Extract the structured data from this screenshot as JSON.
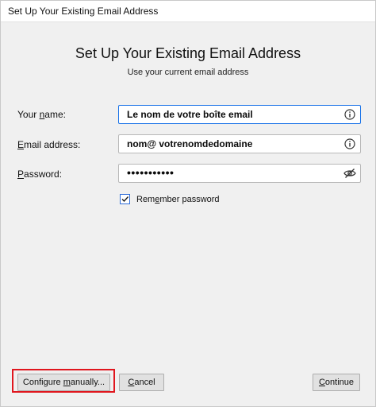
{
  "window": {
    "title": "Set Up Your Existing Email Address"
  },
  "header": {
    "title": "Set Up Your Existing Email Address",
    "subtitle": "Use your current email address"
  },
  "form": {
    "name_label_pre": "Your ",
    "name_label_mn": "n",
    "name_label_post": "ame:",
    "name_value": "Le nom de votre boîte email",
    "email_label_pre": "",
    "email_label_mn": "E",
    "email_label_post": "mail address:",
    "email_value": "nom@ votrenomdedomaine",
    "password_label_pre": "",
    "password_label_mn": "P",
    "password_label_post": "assword:",
    "password_value": "•••••••••••",
    "remember_pre": "Rem",
    "remember_mn": "e",
    "remember_post": "mber password",
    "remember_checked": true
  },
  "footer": {
    "configure_pre": "Configure ",
    "configure_mn": "m",
    "configure_post": "anually...",
    "cancel_pre": "",
    "cancel_mn": "C",
    "cancel_post": "ancel",
    "continue_pre": "",
    "continue_mn": "C",
    "continue_post": "ontinue"
  },
  "icons": {
    "info": "info-icon",
    "eye_hidden": "eye-slash-icon",
    "check": "check-icon"
  },
  "colors": {
    "focus_border": "#1a73e8",
    "highlight_border": "#e0161e",
    "checkbox_border": "#2d6bd8"
  }
}
